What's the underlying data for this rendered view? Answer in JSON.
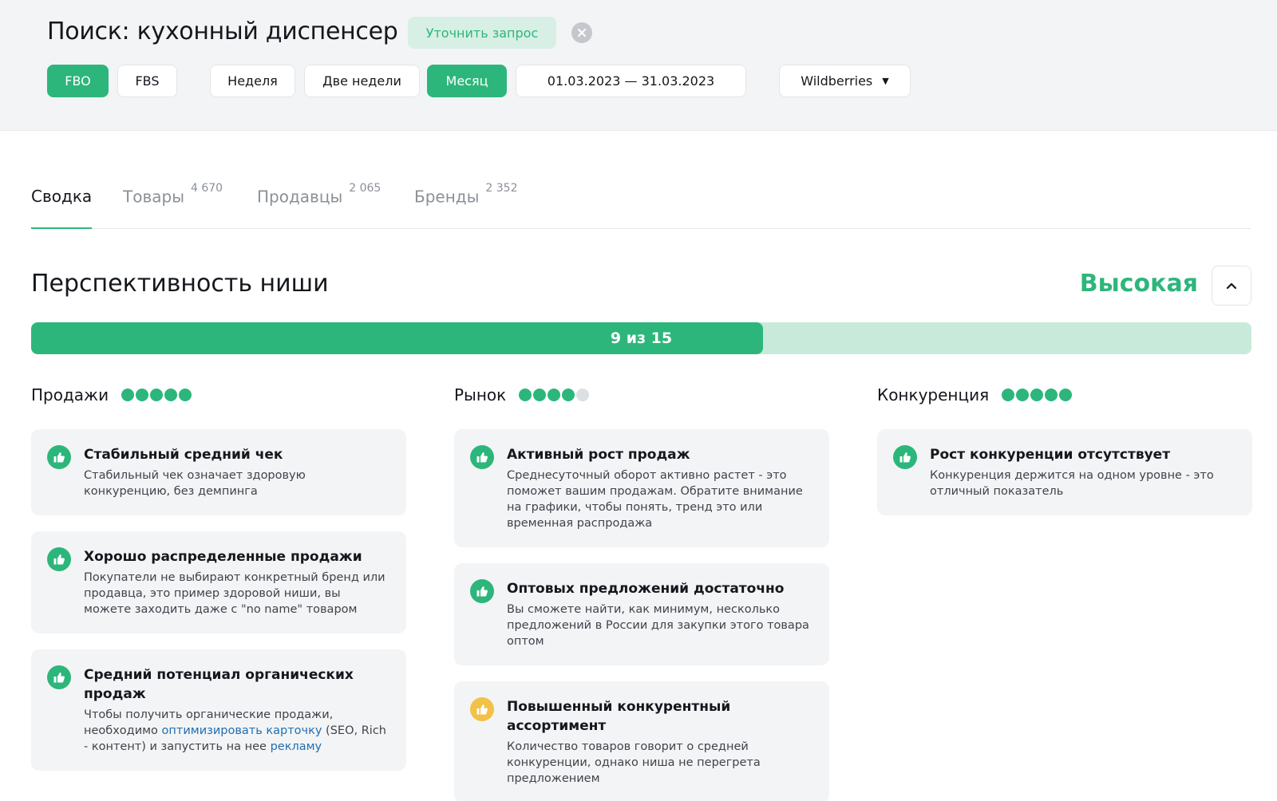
{
  "header": {
    "search_title": "Поиск: кухонный диспенсер",
    "refine_label": "Уточнить запрос",
    "fulfillment": [
      {
        "label": "FBO",
        "active": true
      },
      {
        "label": "FBS",
        "active": false
      }
    ],
    "periods": [
      {
        "label": "Неделя",
        "active": false
      },
      {
        "label": "Две недели",
        "active": false
      },
      {
        "label": "Месяц",
        "active": true
      }
    ],
    "date_range": "01.03.2023 — 31.03.2023",
    "marketplace": "Wildberries"
  },
  "tabs": [
    {
      "label": "Сводка",
      "count": "",
      "active": true
    },
    {
      "label": "Товары",
      "count": "4 670",
      "active": false
    },
    {
      "label": "Продавцы",
      "count": "2 065",
      "active": false
    },
    {
      "label": "Бренды",
      "count": "2 352",
      "active": false
    }
  ],
  "niche": {
    "title": "Перспективность ниши",
    "rating": "Высокая",
    "score": 9,
    "max_score": 15,
    "progress_text": "9 из 15"
  },
  "columns": [
    {
      "title": "Продажи",
      "rating": 5,
      "cards": [
        {
          "status": "good",
          "title": "Стабильный средний чек",
          "text": "Стабильный чек означает здоровую конкуренцию, без демпинга"
        },
        {
          "status": "good",
          "title": "Хорошо распределенные продажи",
          "text": "Покупатели не выбирают конкретный бренд или продавца, это пример здоровой ниши, вы можете заходить даже с \"no name\" товаром"
        },
        {
          "status": "good",
          "title": "Средний потенциал органических продаж",
          "text_parts": [
            "Чтобы получить органические продажи, необходимо ",
            "оптимизировать карточку",
            " (SEO, Rich - контент) и запустить на нее ",
            "рекламу"
          ]
        }
      ]
    },
    {
      "title": "Рынок",
      "rating": 4,
      "cards": [
        {
          "status": "good",
          "title": "Активный рост продаж",
          "text": "Среднесуточный оборот активно растет - это поможет вашим продажам. Обратите внимание на графики, чтобы понять, тренд это или временная распродажа"
        },
        {
          "status": "good",
          "title": "Оптовых предложений достаточно",
          "text": "Вы сможете найти, как минимум, несколько предложений в России для закупки этого товара оптом"
        },
        {
          "status": "warn",
          "title": "Повышенный конкурентный ассортимент",
          "text": "Количество товаров говорит о средней конкуренции, однако ниша не перегрета предложением"
        }
      ]
    },
    {
      "title": "Конкуренция",
      "rating": 5,
      "cards": [
        {
          "status": "good",
          "title": "Рост конкуренции отсутствует",
          "text": "Конкуренция держится на одном уровне - это отличный показатель"
        }
      ]
    }
  ],
  "colors": {
    "accent": "#2db67b",
    "accent_light": "#c8eada",
    "warn": "#f2c147",
    "link": "#1f6fb3"
  },
  "icons": {
    "card_good": "thumbs-up-icon",
    "card_warn": "thumbs-up-icon",
    "close": "close-icon",
    "collapse": "chevron-up-icon",
    "dropdown": "caret-down-icon"
  }
}
